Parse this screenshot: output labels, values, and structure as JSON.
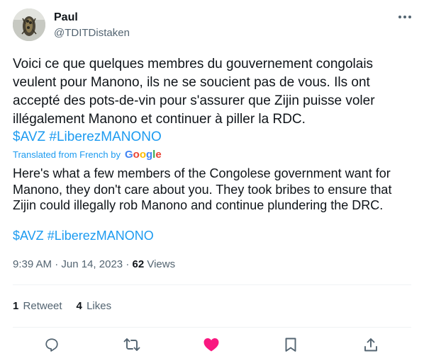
{
  "author": {
    "display_name": "Paul",
    "handle": "@TDITDistaken"
  },
  "tweet": {
    "original_text": "Voici ce que quelques membres du gouvernement congolais veulent pour Manono, ils ne se soucient pas de vous. Ils ont accepté des pots-de-vin pour s'assurer que Zijin puisse voler illégalement Manono et continuer à piller la RDC.",
    "original_cashtag": "$AVZ",
    "original_hashtag": "#LiberezMANONO",
    "translated_label": "Translated from French by",
    "translator_brand": "Google",
    "translated_text": "Here's what a few members of the Congolese government want for Manono, they don't care about you. They took bribes to ensure that Zijin could illegally rob Manono and continue plundering the DRC.",
    "translated_cashtag": "$AVZ",
    "translated_hashtag": "#LiberezMANONO"
  },
  "meta": {
    "time": "9:39 AM",
    "separator": "·",
    "date": "Jun 14, 2023",
    "views_count": "62",
    "views_label": "Views"
  },
  "stats": {
    "retweets_count": "1",
    "retweets_label": "Retweet",
    "likes_count": "4",
    "likes_label": "Likes"
  },
  "icons": {
    "more": "more-horizontal-icon",
    "reply": "reply-icon",
    "retweet": "retweet-icon",
    "like": "heart-icon",
    "bookmark": "bookmark-icon",
    "share": "share-icon"
  },
  "colors": {
    "link": "#1d9bf0",
    "secondary_text": "#536471",
    "like_active": "#f91880",
    "icon": "#536471"
  }
}
